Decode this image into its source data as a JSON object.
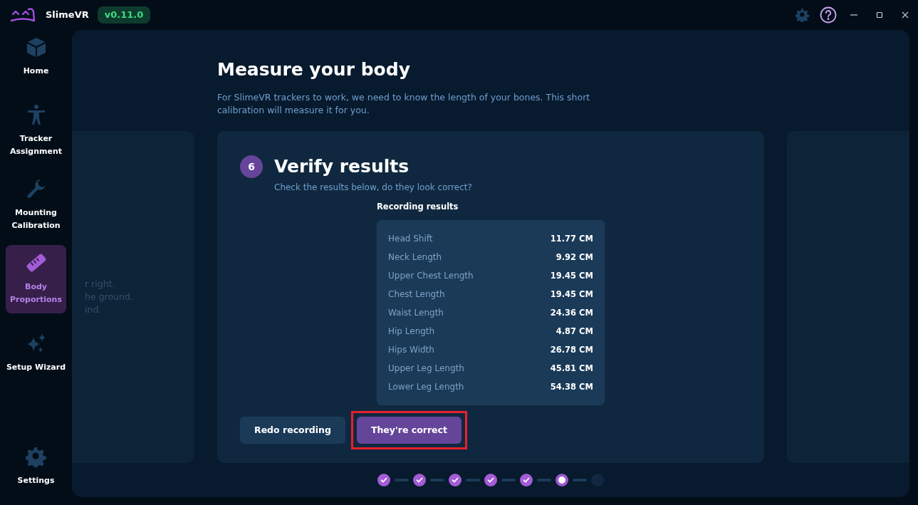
{
  "app": {
    "name": "SlimeVR",
    "version": "v0.11.0"
  },
  "sidebar": {
    "items": [
      {
        "label": "Home",
        "selected": false
      },
      {
        "label": "Tracker Assignment",
        "selected": false
      },
      {
        "label": "Mounting Calibration",
        "selected": false
      },
      {
        "label": "Body Proportions",
        "selected": true
      },
      {
        "label": "Setup Wizard",
        "selected": false
      }
    ],
    "bottom_item": {
      "label": "Settings",
      "selected": false
    }
  },
  "page": {
    "title": "Measure your body",
    "description": "For SlimeVR trackers to work, we need to know the length of your bones. This short calibration will measure it for you."
  },
  "previous_card": {
    "lines": [
      "r right.",
      "he ground.",
      "ind."
    ]
  },
  "step": {
    "number": "6",
    "title": "Verify results",
    "subtitle": "Check the results below, do they look correct?",
    "results_title": "Recording results",
    "results": [
      {
        "name": "Head Shift",
        "value": "11.77 CM"
      },
      {
        "name": "Neck Length",
        "value": "9.92 CM"
      },
      {
        "name": "Upper Chest Length",
        "value": "19.45 CM"
      },
      {
        "name": "Chest Length",
        "value": "19.45 CM"
      },
      {
        "name": "Waist Length",
        "value": "24.36 CM"
      },
      {
        "name": "Hip Length",
        "value": "4.87 CM"
      },
      {
        "name": "Hips Width",
        "value": "26.78 CM"
      },
      {
        "name": "Upper Leg Length",
        "value": "45.81 CM"
      },
      {
        "name": "Lower Leg Length",
        "value": "54.38 CM"
      }
    ],
    "buttons": [
      {
        "label": "Redo recording",
        "kind": "secondary",
        "highlighted": false
      },
      {
        "label": "They're correct",
        "kind": "primary",
        "highlighted": true
      }
    ]
  },
  "progress_steps": [
    {
      "completed": true,
      "selected": false
    },
    {
      "completed": true,
      "selected": false
    },
    {
      "completed": true,
      "selected": false
    },
    {
      "completed": true,
      "selected": false
    },
    {
      "completed": true,
      "selected": false
    },
    {
      "completed": false,
      "selected": true
    },
    {
      "completed": false,
      "selected": false
    }
  ]
}
